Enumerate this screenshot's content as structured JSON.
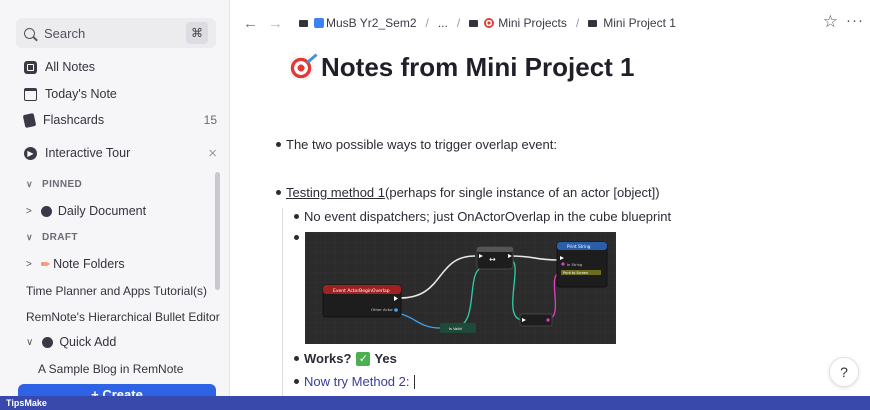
{
  "sidebar": {
    "search": {
      "label": "Search",
      "shortcut": "⌘"
    },
    "nav": [
      {
        "label": "All Notes",
        "icon": "all-notes-icon"
      },
      {
        "label": "Today's Note",
        "icon": "calendar-icon"
      },
      {
        "label": "Flashcards",
        "icon": "flashcards-icon",
        "count": "15"
      },
      {
        "label": "Interactive Tour",
        "icon": "tour-icon",
        "close": "×"
      }
    ],
    "pinned_header": "PINNED",
    "pinned": [
      {
        "label": "Daily Document"
      }
    ],
    "draft_header": "DRAFT",
    "draft": [
      {
        "label": "Note Folders"
      },
      {
        "label": "Time Planner and Apps Tutorial(s)"
      },
      {
        "label": "RemNote's Hierarchical Bullet Editor"
      },
      {
        "label": "Quick Add"
      },
      {
        "label": "A Sample Blog in RemNote"
      }
    ],
    "create_label": "+ Create"
  },
  "topbar": {
    "breadcrumbs": [
      "MusB Yr2_Sem2",
      "...",
      "Mini Projects",
      "Mini Project 1"
    ],
    "separator": "/"
  },
  "document": {
    "title": "Notes from Mini Project 1",
    "bullets": {
      "overlap": "The two possible ways to trigger overlap event:",
      "method1_link": "Testing method 1",
      "method1_rest": " (perhaps for single instance of an actor [object])",
      "no_dispatch": "No event dispatchers; just OnActorOverlap in the cube blueprint",
      "works": "Works?",
      "works_answer": "Yes",
      "method2": "Now try Method 2:"
    },
    "blueprint": {
      "event_node": "Event ActorBeginOverlap",
      "other_actor": "Other Actor",
      "print_node": "Print String",
      "in_string": "In String",
      "on_screen": "Print to Screen",
      "is_valid": "Is Valid"
    }
  },
  "watermark": "TipsMake",
  "help_label": "?",
  "footer": "TipsMake"
}
